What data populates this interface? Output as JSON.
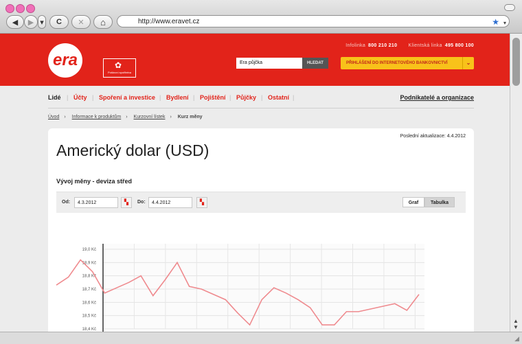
{
  "browser": {
    "url": "http://www.eravet.cz",
    "nav": {
      "back": "◀",
      "forward": "▶",
      "reload": "C",
      "stop": "✕",
      "home": "⌂",
      "star": "★",
      "dropdown": "▾"
    }
  },
  "header": {
    "logo_text": "era",
    "partner_text": "Poštovní spořitelna",
    "infolinka_label": "Infolinka",
    "infolinka_number": "800 210 210",
    "klientska_label": "Klientská linka",
    "klientska_number": "495 800 100",
    "search_value": "Era půjčka",
    "search_button": "HLEDAT",
    "login_button": "PŘIHLÁŠENÍ DO INTERNETOVÉHO BANKOVNICTVÍ",
    "login_chevron": "⌄"
  },
  "mainnav": {
    "items": [
      {
        "label": "Lidé"
      },
      {
        "label": "Účty"
      },
      {
        "label": "Spoření a investice"
      },
      {
        "label": "Bydlení"
      },
      {
        "label": "Pojištění"
      },
      {
        "label": "Půjčky"
      },
      {
        "label": "Ostatní"
      }
    ],
    "right": "Podnikatelé a organizace"
  },
  "breadcrumb": {
    "items": [
      "Úvod",
      "Informace k produktům",
      "Kurzovní lístek",
      "Kurz měny"
    ],
    "separator": "›"
  },
  "page": {
    "updated": "Poslední aktualizace: 4.4.2012",
    "title": "Americký dolar (USD)",
    "subtitle": "Vývoj měny - deviza střed",
    "from_label": "Od:",
    "from_value": "4.3.2012",
    "to_label": "Do:",
    "to_value": "4.4.2012",
    "tab_graph": "Graf",
    "tab_table": "Tabulka"
  },
  "chart_data": {
    "type": "line",
    "y_ticks": [
      "19,0 Kč",
      "18,9 Kč",
      "18,8 Kč",
      "18,7 Kč",
      "18,6 Kč",
      "18,5 Kč",
      "18,4 Kč"
    ],
    "ylim": [
      18.4,
      19.0
    ],
    "series": [
      {
        "values": [
          18.73,
          18.79,
          18.92,
          18.83,
          18.67,
          18.71,
          18.75,
          18.8,
          18.65,
          18.77,
          18.9,
          18.72,
          18.7,
          18.66,
          18.62,
          18.52,
          18.43,
          18.62,
          18.71,
          18.67,
          18.62,
          18.56,
          18.43,
          18.43,
          18.53,
          18.53,
          18.55,
          18.57,
          18.59,
          18.54,
          18.66
        ]
      }
    ],
    "line_color": "#ef8a8e"
  }
}
